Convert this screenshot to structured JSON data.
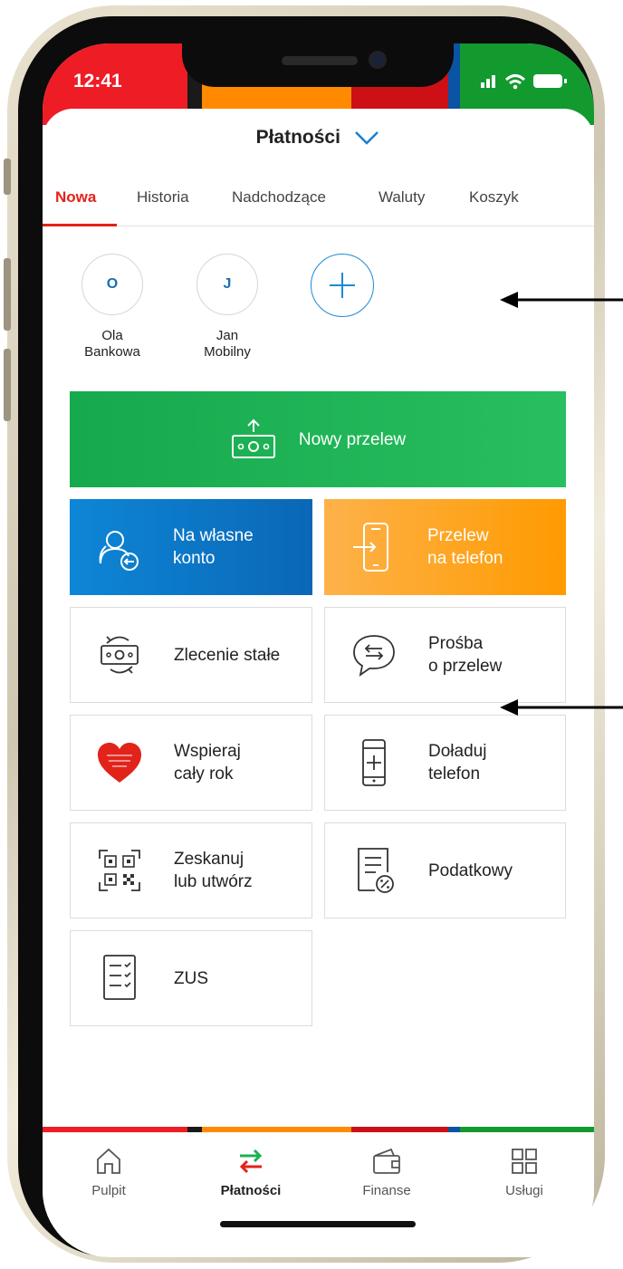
{
  "status": {
    "time": "12:41"
  },
  "header": {
    "title": "Płatności"
  },
  "tabs": [
    {
      "label": "Nowa",
      "active": true
    },
    {
      "label": "Historia"
    },
    {
      "label": "Nadchodzące"
    },
    {
      "label": "Waluty"
    },
    {
      "label": "Koszyk"
    }
  ],
  "contacts": [
    {
      "initial": "O",
      "name_line1": "Ola",
      "name_line2": "Bankowa"
    },
    {
      "initial": "J",
      "name_line1": "Jan",
      "name_line2": "Mobilny"
    }
  ],
  "actions": {
    "new_transfer": "Nowy przelew",
    "own_account": {
      "line1": "Na własne",
      "line2": "konto"
    },
    "phone_transfer": {
      "line1": "Przelew",
      "line2": "na telefon"
    },
    "standing_order": "Zlecenie stałe",
    "transfer_request": {
      "line1": "Prośba",
      "line2": "o przelew"
    },
    "support": {
      "line1": "Wspieraj",
      "line2": "cały rok"
    },
    "top_up": {
      "line1": "Doładuj",
      "line2": "telefon"
    },
    "scan": {
      "line1": "Zeskanuj",
      "line2": "lub utwórz"
    },
    "tax": "Podatkowy",
    "zus": "ZUS"
  },
  "nav": [
    {
      "label": "Pulpit",
      "icon": "home-icon"
    },
    {
      "label": "Płatności",
      "icon": "transfer-icon",
      "active": true
    },
    {
      "label": "Finanse",
      "icon": "wallet-icon"
    },
    {
      "label": "Usługi",
      "icon": "grid-icon"
    }
  ],
  "colors": {
    "accent_red": "#e2231a",
    "green": "#1db055",
    "blue": "#0a74c8",
    "orange": "#fca016"
  }
}
